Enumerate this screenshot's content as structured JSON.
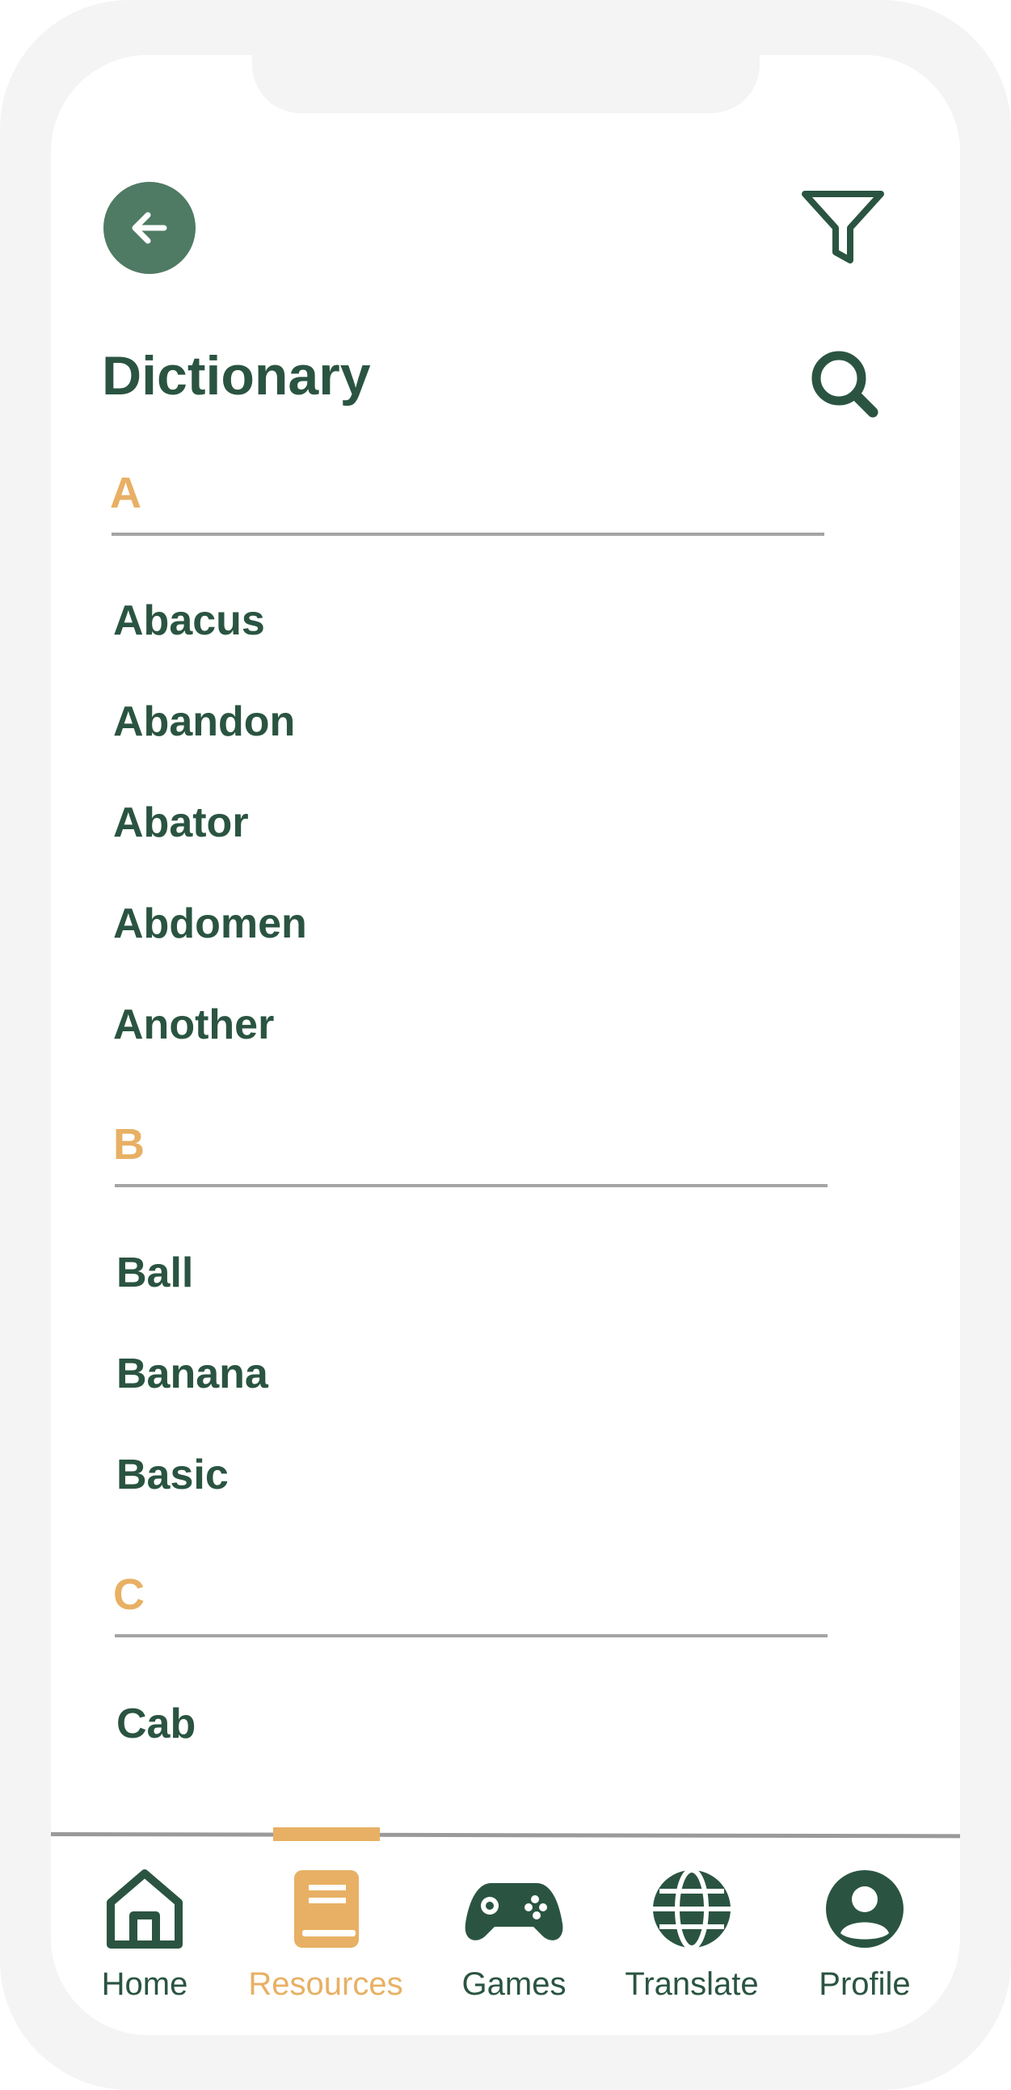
{
  "colors": {
    "primary": "#2a5441",
    "primary_light": "#4f7a63",
    "accent": "#e8b064",
    "divider": "#a4a4a4"
  },
  "header": {
    "back_icon": "arrow-left-icon",
    "filter_icon": "filter-icon",
    "search_icon": "search-icon",
    "title": "Dictionary"
  },
  "sections": [
    {
      "letter": "A",
      "words": [
        "Abacus",
        "Abandon",
        "Abator",
        "Abdomen",
        "Another"
      ]
    },
    {
      "letter": "B",
      "words": [
        "Ball",
        "Banana",
        "Basic"
      ]
    },
    {
      "letter": "C",
      "words": [
        "Cab"
      ]
    }
  ],
  "nav": {
    "active": "Resources",
    "items": [
      {
        "label": "Home",
        "icon": "home-icon"
      },
      {
        "label": "Resources",
        "icon": "book-icon"
      },
      {
        "label": "Games",
        "icon": "gamepad-icon"
      },
      {
        "label": "Translate",
        "icon": "globe-icon"
      },
      {
        "label": "Profile",
        "icon": "user-icon"
      }
    ]
  }
}
